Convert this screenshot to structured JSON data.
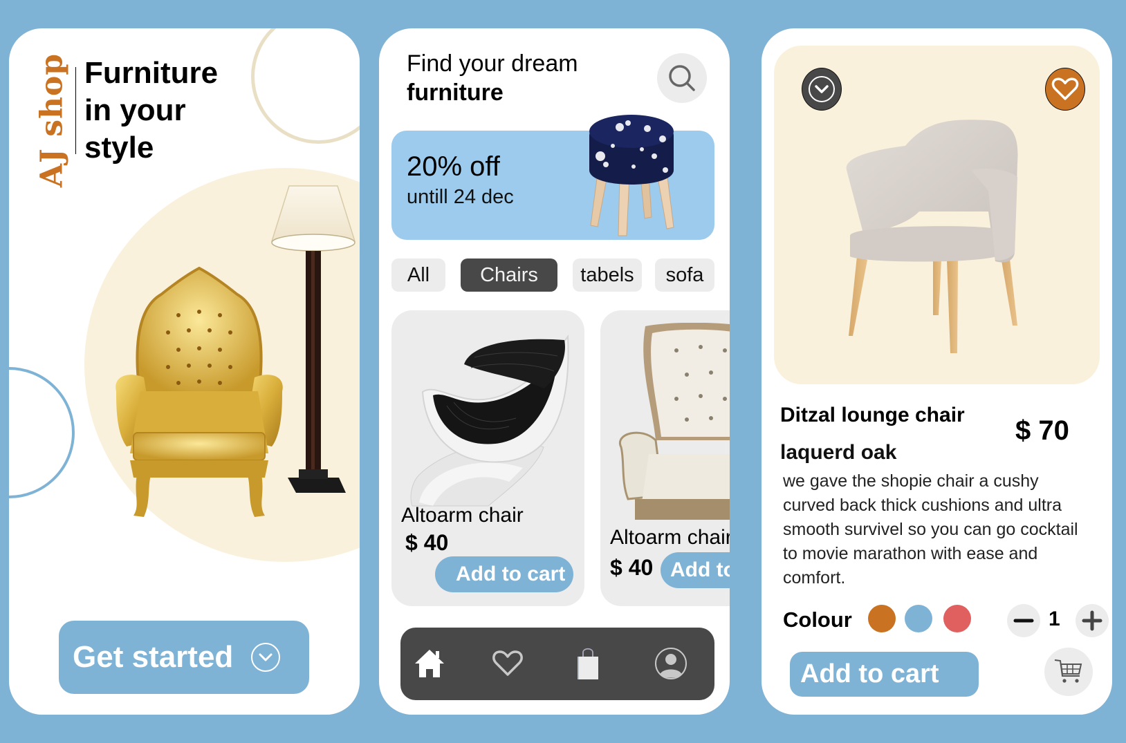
{
  "colors": {
    "background": "#7fb3d6",
    "accent_blue": "#7fb3d6",
    "brand_orange": "#c97322",
    "cream": "#faf1dc",
    "dark": "#484848",
    "banner_blue": "#9ccbee"
  },
  "welcome": {
    "brand": "AJ shop",
    "title_lines": [
      "Furniture",
      "in your",
      "style"
    ],
    "cta_label": "Get started",
    "cta_icon": "chevron-down-circle-icon"
  },
  "home": {
    "title_line1": "Find your dream",
    "title_line2": "furniture",
    "search_icon": "search-icon",
    "banner": {
      "headline": "20% off",
      "subline": "untill 24 dec"
    },
    "categories": [
      {
        "label": "All",
        "active": false
      },
      {
        "label": "Chairs",
        "active": true
      },
      {
        "label": "tabels",
        "active": false
      },
      {
        "label": "sofa",
        "active": false
      }
    ],
    "products": [
      {
        "name": "Altoarm chair",
        "price": "$ 40",
        "add_label": "Add to cart"
      },
      {
        "name": "Altoarm chair",
        "price": "$ 40",
        "add_label": "Add to cart"
      }
    ],
    "nav": [
      {
        "icon": "home-icon",
        "active": true
      },
      {
        "icon": "heart-icon",
        "active": false
      },
      {
        "icon": "shopping-bag-icon",
        "active": false
      },
      {
        "icon": "profile-icon",
        "active": false
      }
    ]
  },
  "detail": {
    "name": "Ditzal lounge chair",
    "material": "laquerd oak",
    "price": "$ 70",
    "description": "we gave the shopie chair a cushy curved back thick cushions and ultra smooth survivel so you can go cocktail to movie marathon with ease and comfort.",
    "colour_label": "Colour",
    "colour_options": [
      "#c97322",
      "#7fb3d6",
      "#e06060"
    ],
    "quantity": "1",
    "add_label": "Add to cart"
  }
}
